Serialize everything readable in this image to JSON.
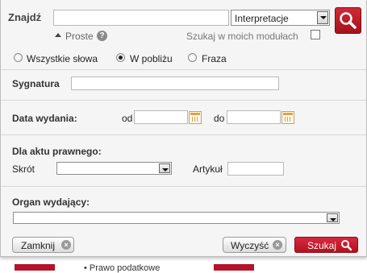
{
  "search": {
    "label": "Znajdź",
    "query_value": "",
    "category_selected": "Interpretacje",
    "simple_link": "Proste",
    "my_modules_label": "Szukaj w moich modułach",
    "my_modules_checked": false
  },
  "match_modes": [
    {
      "label": "Wszystkie słowa",
      "checked": false
    },
    {
      "label": "W pobliżu",
      "checked": true
    },
    {
      "label": "Fraza",
      "checked": false
    }
  ],
  "signature": {
    "label": "Sygnatura",
    "value": ""
  },
  "issue_date": {
    "label": "Data wydania:",
    "from_label": "od",
    "from_value": "",
    "to_label": "do",
    "to_value": ""
  },
  "legal_act": {
    "label": "Dla aktu prawnego:",
    "abbrev_label": "Skrót",
    "abbrev_selected": "",
    "article_label": "Artykuł",
    "article_value": ""
  },
  "issuer": {
    "label": "Organ wydający:",
    "selected": ""
  },
  "buttons": {
    "close": "Zamknij",
    "clear": "Wyczyść",
    "search": "Szukaj"
  },
  "background": {
    "link_text": "• Prawo podatkowe"
  },
  "colors": {
    "accent": "#b5122b"
  }
}
